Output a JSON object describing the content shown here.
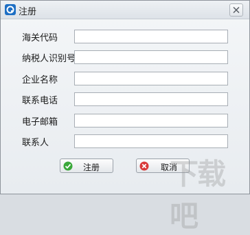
{
  "window": {
    "title": "注册"
  },
  "form": {
    "fields": [
      {
        "label": "海关代码",
        "value": ""
      },
      {
        "label": "纳税人识别号",
        "value": ""
      },
      {
        "label": "企业名称",
        "value": ""
      },
      {
        "label": "联系电话",
        "value": ""
      },
      {
        "label": "电子邮箱",
        "value": ""
      },
      {
        "label": "联系人",
        "value": ""
      }
    ]
  },
  "buttons": {
    "register_label": "注册",
    "cancel_label": "取消"
  },
  "icons": {
    "app": "app-icon",
    "close": "close-icon",
    "register": "check-icon",
    "cancel": "cancel-icon"
  },
  "colors": {
    "accent": "#1e6fc4",
    "check_green": "#3aa83a",
    "cancel_red": "#d93a3a"
  },
  "watermark": "下载吧"
}
